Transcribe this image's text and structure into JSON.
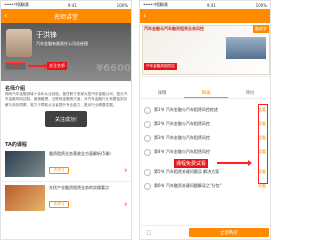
{
  "left": {
    "status": {
      "carrier": "••••• 中国联通",
      "time": "9:41",
      "battery": "100%"
    },
    "nav": {
      "title": "名师讲堂",
      "back": "‹"
    },
    "teacher": {
      "name": "于洪锋",
      "title": "汽车金融有限责任公司总经理",
      "follow_label": "已关注",
      "annotation": "关注名师",
      "bg_price": "¥6600"
    },
    "intro": {
      "heading": "名师介绍",
      "text": "拥有汽车金融领域十余年从业经验，曾任职于多家大型汽车金融公司，擅长汽车金融风险控制、营销管理、互联网金融等方面，对汽车金融行业有着独到见解与深刻洞察，致力于帮助从业者提升专业能力，推动行业健康发展。"
    },
    "toast": "关注成功!",
    "courses_heading": "TA的课程",
    "courses": [
      {
        "title": "融资租赁业务营收全方面解析(5课)",
        "btn": "去学习",
        "price": "¥"
      },
      {
        "title": "光伏产业融资租赁业务的实操要点",
        "btn": "去学习",
        "price": "¥"
      }
    ]
  },
  "right": {
    "status": {
      "carrier": "••••• 中国联通",
      "time": "9:41",
      "battery": "100%"
    },
    "nav": {
      "back": "‹"
    },
    "banner": {
      "title": "汽车金融与汽车融资租赁业务风控",
      "logo": "融易学",
      "tag1": "汽车金融风险防控",
      "tag2": "评价"
    },
    "tabs": [
      "详情",
      "目录",
      "评价"
    ],
    "lessons": [
      {
        "text": "第1节  汽车金融与汽车租赁风控综述",
        "trial": "试看"
      },
      {
        "text": "第2节  汽车金融与汽车租赁风控",
        "trial": "试看"
      },
      {
        "text": "第3节  汽车金融与汽车租赁风控",
        "trial": "试看"
      },
      {
        "text": "第4节  汽车金融与汽车租赁风控",
        "trial": "试看"
      },
      {
        "text": "第5节  汽车租赁关键问题及 解决方案",
        "trial": "试看"
      },
      {
        "text": "第6节  汽车融资关键问题解读之\"分包\"",
        "trial": "试看"
      }
    ],
    "annotation": "课程免费试看",
    "bottom": {
      "buy_label": "立即购买"
    }
  },
  "colors": {
    "accent": "#ff8a00",
    "annotation": "#e8141b"
  }
}
